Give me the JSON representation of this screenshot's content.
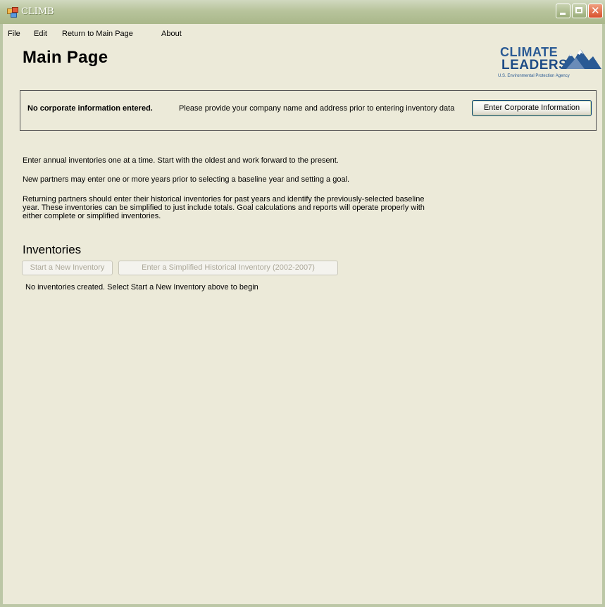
{
  "window": {
    "title": "CLIMB",
    "controls": {
      "minimize": "minimize",
      "maximize": "maximize",
      "close": "✕"
    }
  },
  "menu": {
    "items": [
      "File",
      "Edit",
      "Return to Main Page",
      "About"
    ]
  },
  "page": {
    "title": "Main Page"
  },
  "logo": {
    "line1": "CLIMATE",
    "line2": "LEADERS",
    "line3": "U.S. Environmental Protection Agency"
  },
  "corporate_info": {
    "bold_text": "No corporate information entered.",
    "message": "Please provide your company name and address prior to entering inventory data",
    "button_label": "Enter Corporate Information"
  },
  "instructions": {
    "p1": "Enter annual inventories one at a time. Start with the oldest and work forward to the present.",
    "p2": "New partners may enter one or more years prior to selecting a baseline year and setting a goal.",
    "p3_line1": "Returning partners should enter their historical inventories for past years and identify the previously-selected baseline",
    "p3_line2": "year. These inventories can be simplified to just include totals. Goal calculations and reports will operate properly with",
    "p3_line3": "either complete or simplified inventories."
  },
  "inventories": {
    "title": "Inventories",
    "new_button": "Start a New Inventory",
    "simplified_button": "Enter a Simplified Historical Inventory (2002-2007)",
    "empty_message": "No inventories created.  Select Start a New Inventory above to begin"
  },
  "colors": {
    "background": "#ecead9",
    "titlebar": "#b8c49c",
    "logo_blue": "#1e4c86"
  }
}
